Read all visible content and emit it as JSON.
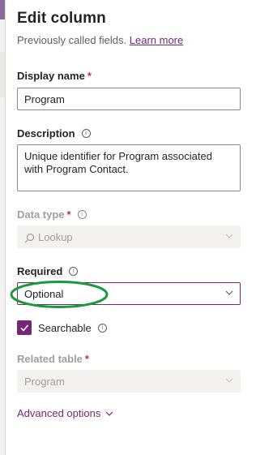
{
  "panel": {
    "title": "Edit column",
    "subtitle": "Previously called fields.",
    "learn_more": "Learn more"
  },
  "display_name": {
    "label": "Display name",
    "required_marker": "*",
    "value": "Program"
  },
  "description": {
    "label": "Description",
    "info_glyph": "i",
    "value": "Unique identifier for Program associated with Program Contact."
  },
  "data_type": {
    "label": "Data type",
    "required_marker": "*",
    "info_glyph": "i",
    "value": "Lookup",
    "icon": "search-icon",
    "disabled": true
  },
  "required": {
    "label": "Required",
    "info_glyph": "i",
    "selected": "Optional",
    "annotation": "green-oval-highlight"
  },
  "searchable": {
    "label": "Searchable",
    "checked": true,
    "info_glyph": "i"
  },
  "related_table": {
    "label": "Related table",
    "required_marker": "*",
    "value": "Program",
    "disabled": true
  },
  "advanced": {
    "label": "Advanced options"
  },
  "colors": {
    "accent": "#742774",
    "required": "#c4314b",
    "annotation": "#1a9a3a",
    "disabled_bg": "#f3f2f1"
  }
}
